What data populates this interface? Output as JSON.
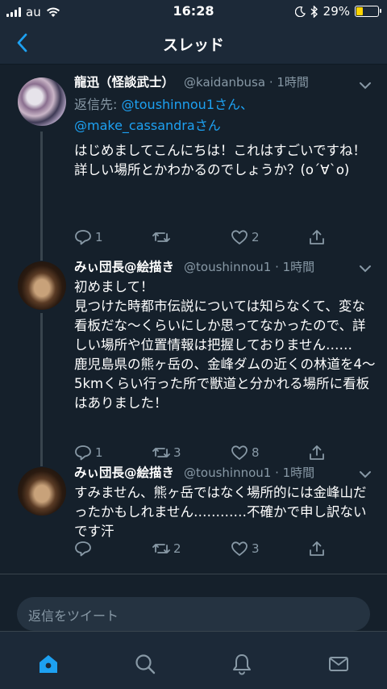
{
  "status_bar": {
    "carrier": "au",
    "time": "16:28",
    "battery": "29%",
    "battery_level": 0.29
  },
  "nav": {
    "title": "スレッド",
    "back_icon": "chevron-left-icon"
  },
  "tweets": [
    {
      "name": "龍迅（怪談武士）",
      "handle": "@kaidanbusa · 1時間",
      "reply_label": "返信先: ",
      "reply_to_1": "@toushinnou1さん、",
      "reply_to_2": "@make_cassandraさん",
      "body": "はじめましてこんにちは！これはすごいですね！\n詳しい場所とかわかるのでしょうか？(o´∀`o)",
      "reply_count": "1",
      "retweet_count": "",
      "like_count": "2"
    },
    {
      "name": "みぃ団長@絵描き",
      "handle": "@toushinnou1 · 1時間",
      "body": "初めまして！\n見つけた時都市伝説については知らなくて、変な看板だな〜くらいにしか思ってなかったので、詳しい場所や位置情報は把握しておりません……\n鹿児島県の熊ヶ岳の、金峰ダムの近くの林道を4〜5kmくらい行った所で獣道と分かれる場所に看板はありました！",
      "reply_count": "1",
      "retweet_count": "3",
      "like_count": "8"
    },
    {
      "name": "みぃ団長@絵描き",
      "handle": "@toushinnou1 · 1時間",
      "body": "すみません、熊ヶ岳ではなく場所的には金峰山だったかもしれません…………不確かで申し訳ないです汗",
      "reply_count": "",
      "retweet_count": "2",
      "like_count": "3"
    }
  ],
  "reply_bar": {
    "placeholder": "返信をツイート"
  },
  "tabbar": {
    "items": [
      "home-icon",
      "search-icon",
      "notifications-icon",
      "messages-icon"
    ],
    "active": "home-icon"
  },
  "colors": {
    "background": "#15202b",
    "bar": "#1c2938",
    "accent": "#1da1f2",
    "secondary_text": "#8899a6",
    "battery": "#ffd400"
  }
}
